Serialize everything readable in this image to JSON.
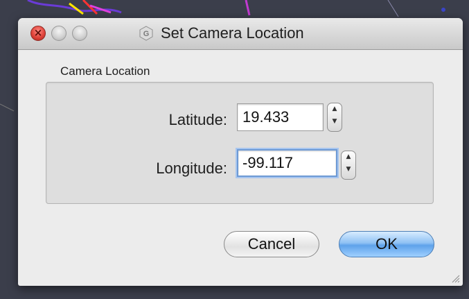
{
  "window": {
    "title": "Set Camera Location",
    "app_icon": "g-hexagon-icon"
  },
  "form": {
    "group_title": "Camera Location",
    "latitude": {
      "label": "Latitude:",
      "value": "19.433"
    },
    "longitude": {
      "label": "Longitude:",
      "value": "-99.117"
    }
  },
  "buttons": {
    "cancel_label": "Cancel",
    "ok_label": "OK"
  },
  "colors": {
    "close_button": "#e0443b",
    "default_button": "#5ea2ea",
    "focus_ring": "#6d9ad5"
  }
}
